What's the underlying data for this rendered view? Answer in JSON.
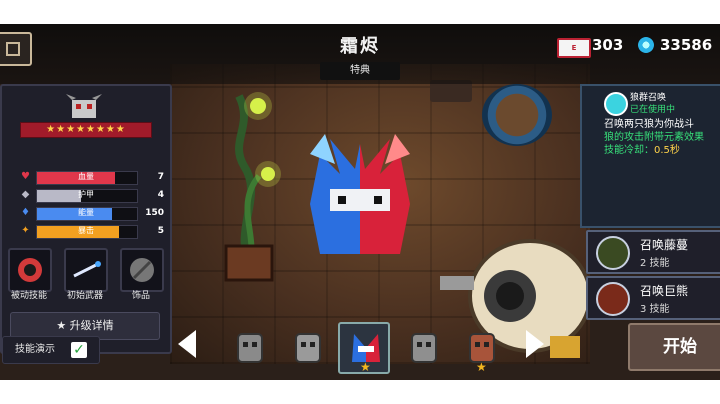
{
  "header": {
    "title": "霜烬",
    "subtitle": "特典"
  },
  "currency": {
    "gem_icon": "gem-chest-icon",
    "gem_icon_text": "E",
    "gems": "303",
    "coin_icon": "blue-coin-icon",
    "coins": "33586"
  },
  "character": {
    "stars": "★★★★★★★★",
    "stats": [
      {
        "icon": "heart-icon",
        "label": "血量",
        "value": "7",
        "fraction": 0.78,
        "color": "#e0374b"
      },
      {
        "icon": "shield-icon",
        "label": "护甲",
        "value": "4",
        "fraction": 0.44,
        "color": "#b9b9c7"
      },
      {
        "icon": "diamond-icon",
        "label": "能量",
        "value": "150",
        "fraction": 0.75,
        "color": "#4a8bf0"
      },
      {
        "icon": "crit-icon",
        "label": "暴击",
        "value": "5",
        "fraction": 0.82,
        "color": "#f3a020"
      }
    ],
    "equipment": [
      {
        "label": "被动技能",
        "icon": "passive-skill-icon"
      },
      {
        "label": "初始武器",
        "icon": "starting-weapon-icon"
      },
      {
        "label": "饰品",
        "icon": "accessory-icon"
      }
    ],
    "upgrade_button": "★ 升级详情"
  },
  "skill_demo": {
    "label": "技能演示",
    "checked": true,
    "check": "✓"
  },
  "active_skill": {
    "icon": "paw-icon",
    "name": "狼群召唤",
    "status": "已在使用中",
    "lines": [
      {
        "text": "召唤两只狼为你战斗",
        "color": "#ffffff"
      },
      {
        "text": "狼的攻击附带元素效果",
        "color": "#37e07a"
      },
      {
        "text": "技能冷却：",
        "color": "#37e07a",
        "suffix": "0.5秒",
        "suffix_color": "#ffd34a"
      }
    ]
  },
  "other_skills": [
    {
      "name": "召唤藤蔓",
      "level": "2 技能",
      "icon": "vine-icon"
    },
    {
      "name": "召唤巨熊",
      "level": "3 技能",
      "icon": "bear-icon"
    }
  ],
  "start_button": "开始",
  "skins": [
    {
      "icon": "skin-grey-1-icon"
    },
    {
      "icon": "skin-grey-2-icon"
    },
    {
      "icon": "skin-frost-ember-icon",
      "selected": true,
      "star": "★"
    },
    {
      "icon": "skin-grey-3-icon"
    },
    {
      "icon": "skin-red-icon",
      "star": "★"
    }
  ],
  "colors": {
    "accent_green": "#37e07a",
    "hp_red": "#e0374b",
    "energy_blue": "#4a8bf0",
    "crit_orange": "#f3a020",
    "star_gold": "#ffd34a"
  }
}
